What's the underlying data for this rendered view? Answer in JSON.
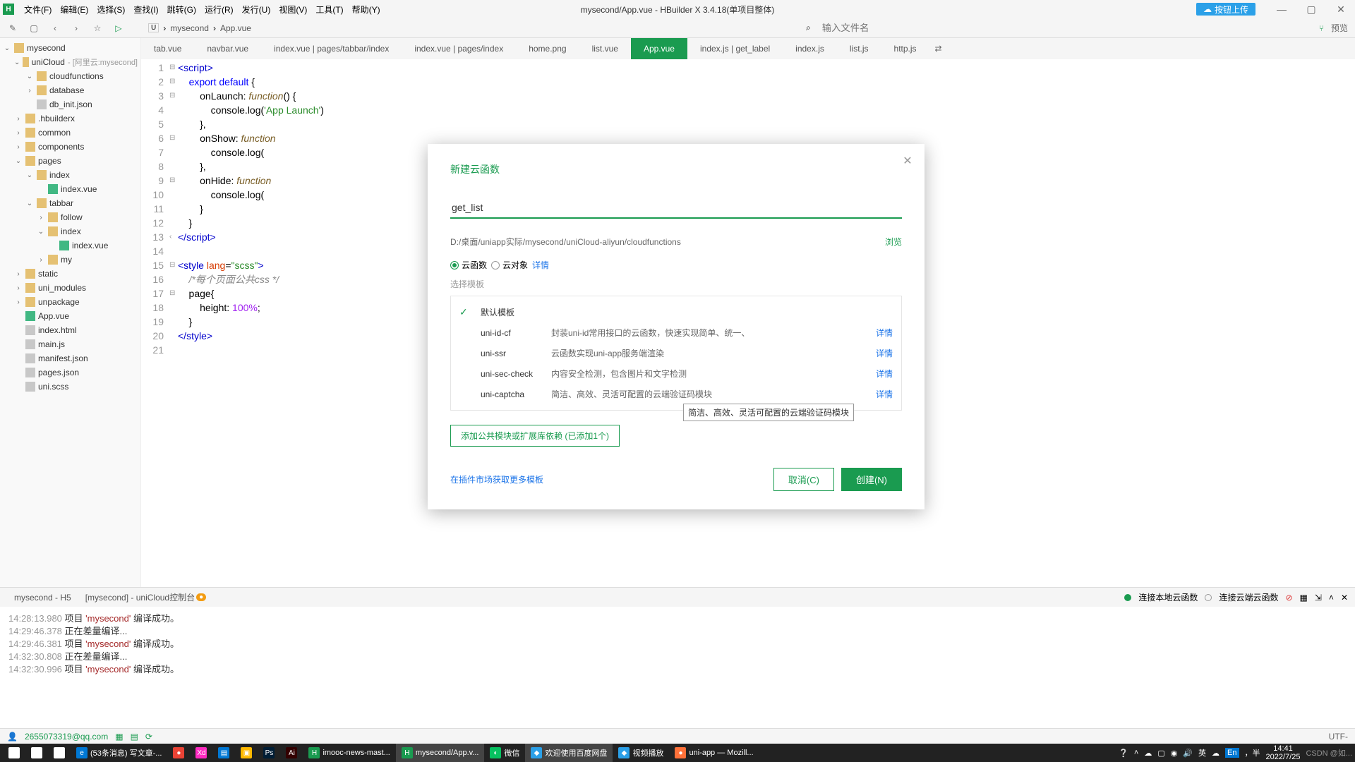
{
  "window": {
    "title": "mysecond/App.vue - HBuilder X 3.4.18(单项目整体)"
  },
  "titlebar_logo": "H",
  "menubar": [
    "文件(F)",
    "编辑(E)",
    "选择(S)",
    "查找(I)",
    "跳转(G)",
    "运行(R)",
    "发行(U)",
    "视图(V)",
    "工具(T)",
    "帮助(Y)"
  ],
  "cloud_btn": "按钮上传",
  "win_btns": {
    "min": "—",
    "max": "▢",
    "close": "✕"
  },
  "toolbar": {
    "new": "✎",
    "save": "▢",
    "back": "‹",
    "fwd": "›",
    "star": "☆",
    "play": "▷",
    "pathbox": "U",
    "search_icon": "⌕"
  },
  "breadcrumb": [
    "mysecond",
    "App.vue"
  ],
  "search_placeholder": "输入文件名",
  "preview_btn": "预览",
  "tree": [
    {
      "d": 0,
      "o": "open",
      "i": "folder",
      "t": "mysecond"
    },
    {
      "d": 1,
      "o": "open",
      "i": "folder",
      "t": "uniCloud",
      "sx": "- [阿里云:mysecond]"
    },
    {
      "d": 2,
      "o": "open",
      "i": "folder",
      "t": "cloudfunctions"
    },
    {
      "d": 2,
      "o": "closed",
      "i": "folder",
      "t": "database"
    },
    {
      "d": 2,
      "o": "",
      "i": "file",
      "t": "db_init.json"
    },
    {
      "d": 1,
      "o": "closed",
      "i": "folder",
      "t": ".hbuilderx"
    },
    {
      "d": 1,
      "o": "closed",
      "i": "folder",
      "t": "common"
    },
    {
      "d": 1,
      "o": "closed",
      "i": "folder",
      "t": "components"
    },
    {
      "d": 1,
      "o": "open",
      "i": "folder",
      "t": "pages"
    },
    {
      "d": 2,
      "o": "open",
      "i": "folder",
      "t": "index"
    },
    {
      "d": 3,
      "o": "",
      "i": "vue",
      "t": "index.vue"
    },
    {
      "d": 2,
      "o": "open",
      "i": "folder",
      "t": "tabbar"
    },
    {
      "d": 3,
      "o": "closed",
      "i": "folder",
      "t": "follow"
    },
    {
      "d": 3,
      "o": "open",
      "i": "folder",
      "t": "index"
    },
    {
      "d": 4,
      "o": "",
      "i": "vue",
      "t": "index.vue"
    },
    {
      "d": 3,
      "o": "closed",
      "i": "folder",
      "t": "my"
    },
    {
      "d": 1,
      "o": "closed",
      "i": "folder",
      "t": "static"
    },
    {
      "d": 1,
      "o": "closed",
      "i": "folder",
      "t": "uni_modules"
    },
    {
      "d": 1,
      "o": "closed",
      "i": "folder",
      "t": "unpackage"
    },
    {
      "d": 1,
      "o": "",
      "i": "vue",
      "t": "App.vue"
    },
    {
      "d": 1,
      "o": "",
      "i": "file",
      "t": "index.html"
    },
    {
      "d": 1,
      "o": "",
      "i": "file",
      "t": "main.js"
    },
    {
      "d": 1,
      "o": "",
      "i": "file",
      "t": "manifest.json"
    },
    {
      "d": 1,
      "o": "",
      "i": "file",
      "t": "pages.json"
    },
    {
      "d": 1,
      "o": "",
      "i": "file",
      "t": "uni.scss"
    }
  ],
  "tabs": [
    {
      "l": "tab.vue"
    },
    {
      "l": "navbar.vue"
    },
    {
      "l": "index.vue | pages/tabbar/index"
    },
    {
      "l": "index.vue | pages/index"
    },
    {
      "l": "home.png"
    },
    {
      "l": "list.vue"
    },
    {
      "l": "App.vue",
      "active": true
    },
    {
      "l": "index.js | get_label"
    },
    {
      "l": "index.js"
    },
    {
      "l": "list.js"
    },
    {
      "l": "http.js"
    }
  ],
  "more_tabs": "⇄",
  "console_tabs": [
    {
      "l": "mysecond - H5",
      "active": true
    },
    {
      "l": "[mysecond] - uniCloud控制台",
      "badge": "●"
    }
  ],
  "console_status": [
    {
      "dot": "green",
      "t": "连接本地云函数"
    },
    {
      "dot": "gray",
      "t": "连接云端云函数"
    }
  ],
  "console_lines": [
    {
      "ts": "14:28:13.980",
      "txt": "项目 'mysecond' 编译成功。"
    },
    {
      "ts": "14:29:46.378",
      "txt": "正在差量编译..."
    },
    {
      "ts": "14:29:46.381",
      "txt": "项目 'mysecond' 编译成功。"
    },
    {
      "ts": "14:32:30.808",
      "txt": "正在差量编译..."
    },
    {
      "ts": "14:32:30.996",
      "txt": "项目 'mysecond' 编译成功。"
    }
  ],
  "status": {
    "email": "2655073319@qq.com",
    "encoding": "UTF-"
  },
  "taskbar": [
    {
      "l": "",
      "i": "⊞",
      "c": "#fff"
    },
    {
      "l": "",
      "i": "○",
      "c": "#fff"
    },
    {
      "l": "",
      "i": "▭",
      "c": "#fff"
    },
    {
      "l": "(53条消息) 写文章-...",
      "i": "e",
      "c": "#0078d4"
    },
    {
      "l": "",
      "i": "●",
      "c": "#ea4335"
    },
    {
      "l": "",
      "i": "Xd",
      "c": "#ff2bc2"
    },
    {
      "l": "",
      "i": "▤",
      "c": "#0078d4"
    },
    {
      "l": "",
      "i": "▣",
      "c": "#ffb900"
    },
    {
      "l": "",
      "i": "Ps",
      "c": "#001e36"
    },
    {
      "l": "",
      "i": "Ai",
      "c": "#330000"
    },
    {
      "l": "imooc-news-mast...",
      "i": "H",
      "c": "#1a9b50"
    },
    {
      "l": "mysecond/App.v...",
      "i": "H",
      "c": "#1a9b50",
      "active": true
    },
    {
      "l": "微信",
      "i": "◐",
      "c": "#07c160"
    },
    {
      "l": "欢迎使用百度网盘",
      "i": "◆",
      "c": "#2ba0e8",
      "active": true
    },
    {
      "l": "视频播放",
      "i": "◆",
      "c": "#2ba0e8"
    },
    {
      "l": "uni-app — Mozill...",
      "i": "●",
      "c": "#ff7139"
    }
  ],
  "tray": {
    "icons": [
      "❔",
      "˄",
      "☁",
      "▢",
      "◉",
      "🔊",
      "英",
      "☁"
    ],
    "ime": "En",
    "ime2": "，半",
    "time": "14:41",
    "date": "2022/7/25",
    "watermark": "CSDN @如..."
  },
  "dialog": {
    "title": "新建云函数",
    "close": "✕",
    "name_value": "get_list",
    "path": "D:/桌面/uniapp实际/mysecond/uniCloud-aliyun/cloudfunctions",
    "browse": "浏览",
    "radio1": "云函数",
    "radio2": "云对象",
    "radio_detail": "详情",
    "tpl_header": "选择模板",
    "templates": [
      {
        "sel": true,
        "n": "默认模板",
        "d": "",
        "link": ""
      },
      {
        "sel": false,
        "n": "uni-id-cf",
        "d": "封装uni-id常用接口的云函数，快速实现简单、统一、",
        "link": "详情"
      },
      {
        "sel": false,
        "n": "uni-ssr",
        "d": "云函数实现uni-app服务端渲染",
        "link": "详情"
      },
      {
        "sel": false,
        "n": "uni-sec-check",
        "d": "内容安全检测，包含图片和文字检测",
        "link": "详情"
      },
      {
        "sel": false,
        "n": "uni-captcha",
        "d": "简洁、高效、灵活可配置的云端验证码模块",
        "link": "详情"
      }
    ],
    "add_btn": "添加公共模块或扩展库依赖 (已添加1个)",
    "more_link": "在插件市场获取更多模板",
    "cancel": "取消(C)",
    "create": "创建(N)",
    "tooltip": "简洁、高效、灵活可配置的云端验证码模块"
  }
}
